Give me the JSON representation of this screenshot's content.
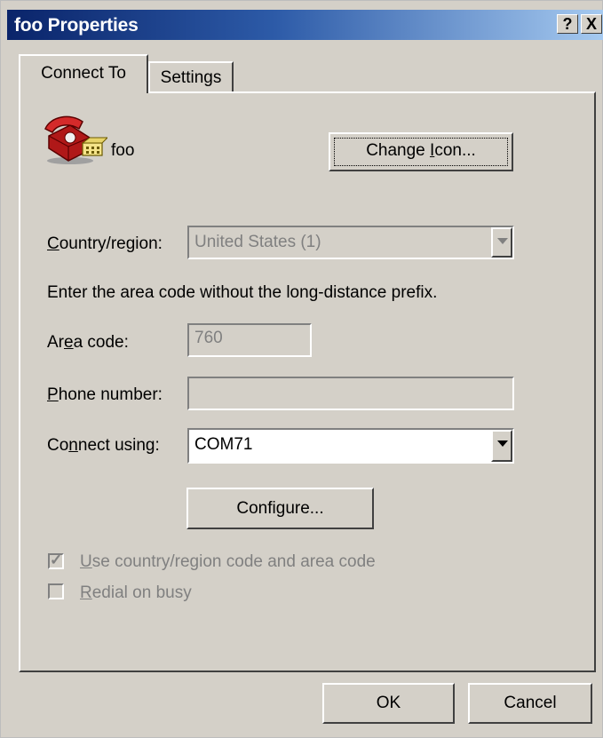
{
  "window": {
    "title": "foo Properties",
    "help_icon": "?",
    "close_icon": "X"
  },
  "tabs": [
    {
      "label": "Connect To",
      "active": true
    },
    {
      "label": "Settings",
      "active": false
    }
  ],
  "connection": {
    "name": "foo",
    "icon": "telephone-icon",
    "change_icon_button": {
      "pre": "Change ",
      "key": "I",
      "post": "con..."
    }
  },
  "country": {
    "label": {
      "pre": "",
      "key": "C",
      "post": "ountry/region:"
    },
    "value": "United States (1)",
    "enabled": false
  },
  "hint": "Enter the area code without the long-distance prefix.",
  "area_code": {
    "label": {
      "pre": "Ar",
      "key": "e",
      "post": "a code:"
    },
    "value": "760",
    "enabled": false
  },
  "phone_number": {
    "label": {
      "pre": "",
      "key": "P",
      "post": "hone number:"
    },
    "value": "",
    "enabled": false
  },
  "connect_using": {
    "label": {
      "pre": "Co",
      "key": "n",
      "post": "nect using:"
    },
    "value": "COM71"
  },
  "configure_button": {
    "pre": "Confi",
    "key": "g",
    "post": "ure..."
  },
  "checkboxes": [
    {
      "label": {
        "pre": "",
        "key": "U",
        "post": "se country/region code and area code"
      },
      "checked": true,
      "enabled": false
    },
    {
      "label": {
        "pre": "",
        "key": "R",
        "post": "edial on busy"
      },
      "checked": false,
      "enabled": false
    }
  ],
  "buttons": {
    "ok": "OK",
    "cancel": "Cancel"
  }
}
